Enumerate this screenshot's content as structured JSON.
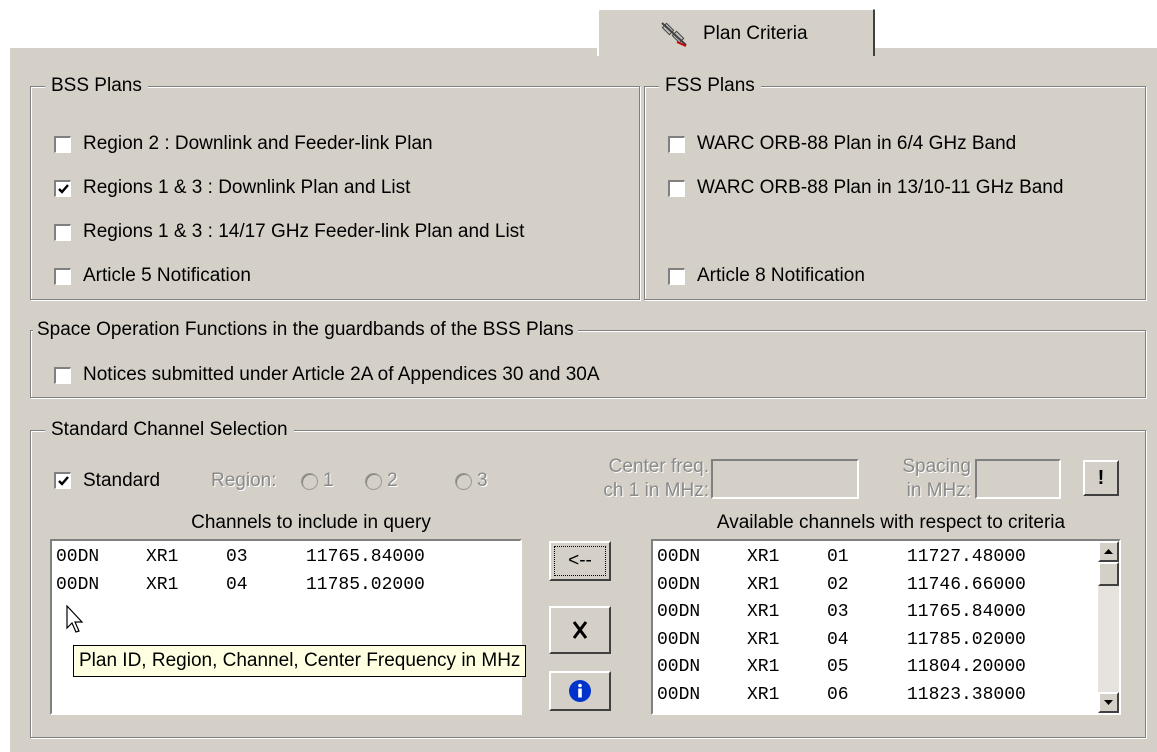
{
  "tab": {
    "label": "Plan Criteria",
    "icon": "satellite-icon"
  },
  "bss": {
    "title": "BSS Plans",
    "items": [
      {
        "label": "Region  2       : Downlink and Feeder-link Plan",
        "checked": false
      },
      {
        "label": "Regions 1 & 3 : Downlink Plan and List",
        "checked": true
      },
      {
        "label": "Regions 1 & 3 : 14/17 GHz Feeder-link Plan and List",
        "checked": false
      },
      {
        "label": "Article 5 Notification",
        "checked": false
      }
    ]
  },
  "fss": {
    "title": "FSS Plans",
    "items": [
      {
        "label": "WARC ORB-88 Plan in 6/4 GHz Band",
        "checked": false
      },
      {
        "label": "WARC ORB-88 Plan in 13/10-11 GHz Band",
        "checked": false
      },
      {
        "label": "Article 8 Notification",
        "checked": false
      }
    ]
  },
  "space_ops": {
    "title": "Space Operation Functions in the guardbands of the BSS Plans",
    "item": {
      "label": "Notices submitted under Article 2A of Appendices 30 and 30A",
      "checked": false
    }
  },
  "std": {
    "title": "Standard Channel Selection",
    "standard_label": "Standard",
    "standard_checked": true,
    "region_label": "Region:",
    "regions": [
      "1",
      "2",
      "3"
    ],
    "center_freq_label_1": "Center freq.",
    "center_freq_label_2": "ch 1 in MHz:",
    "center_freq_value": "",
    "spacing_label_1": "Spacing",
    "spacing_label_2": "in MHz:",
    "spacing_value": "",
    "apply_button": "!",
    "include_heading": "Channels to include in query",
    "available_heading": "Available channels with respect to criteria",
    "included": [
      [
        "00DN",
        "XR1",
        "03",
        "11765.84000"
      ],
      [
        "00DN",
        "XR1",
        "04",
        "11785.02000"
      ]
    ],
    "available": [
      [
        "00DN",
        "XR1",
        "01",
        "11727.48000"
      ],
      [
        "00DN",
        "XR1",
        "02",
        "11746.66000"
      ],
      [
        "00DN",
        "XR1",
        "03",
        "11765.84000"
      ],
      [
        "00DN",
        "XR1",
        "04",
        "11785.02000"
      ],
      [
        "00DN",
        "XR1",
        "05",
        "11804.20000"
      ],
      [
        "00DN",
        "XR1",
        "06",
        "11823.38000"
      ]
    ],
    "add_button": "<--",
    "remove_button_icon": "remove-icon",
    "info_button_icon": "info-icon"
  },
  "tooltip": "Plan ID, Region, Channel, Center Frequency in MHz",
  "colors": {
    "face": "#d4d0c8",
    "tooltip_bg": "#ffffe1",
    "info_blue": "#0033cc"
  }
}
